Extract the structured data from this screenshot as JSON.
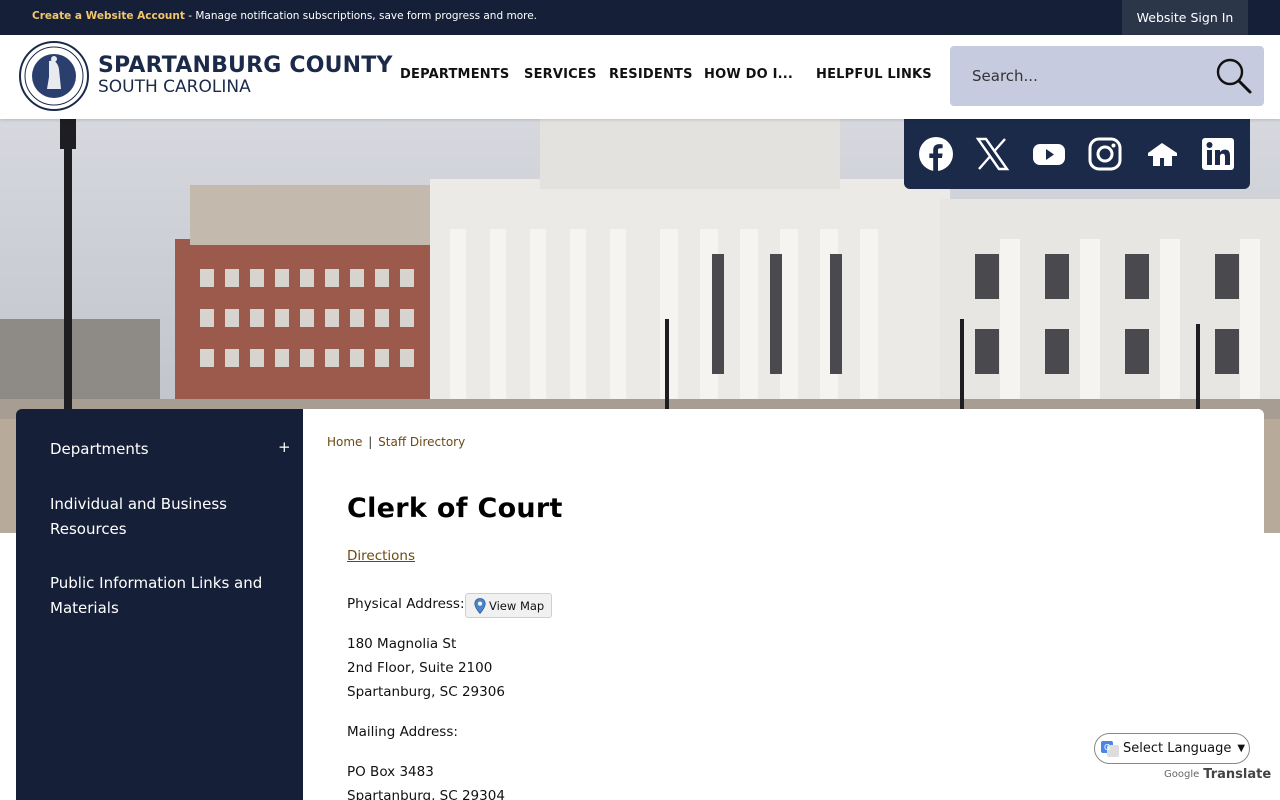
{
  "topbar": {
    "promo_link": "Create a Website Account",
    "promo_text": " - Manage notification subscriptions, save form progress and more.",
    "signin": "Website Sign In"
  },
  "header": {
    "site_title": "SPARTANBURG COUNTY",
    "site_subtitle": "SOUTH CAROLINA",
    "nav": [
      "DEPARTMENTS",
      "SERVICES",
      "RESIDENTS",
      "HOW DO I...",
      "HELPFUL LINKS"
    ],
    "search_placeholder": "Search..."
  },
  "social": [
    "facebook-icon",
    "x-icon",
    "youtube-icon",
    "instagram-icon",
    "nextdoor-icon",
    "linkedin-icon"
  ],
  "sidebar": {
    "items": [
      {
        "label": "Departments",
        "toggle": "+"
      },
      {
        "label": "Individual and Business Resources"
      },
      {
        "label": "Public Information Links and Materials"
      }
    ]
  },
  "main": {
    "breadcrumb": {
      "home": "Home",
      "sep": "|",
      "current": "Staff Directory"
    },
    "title": "Clerk of Court",
    "directions": "Directions",
    "physical_label": "Physical Address:",
    "view_map": "View Map",
    "physical_address": [
      "180 Magnolia St",
      "2nd Floor, Suite 2100",
      "Spartanburg, SC 29306"
    ],
    "mailing_label": "Mailing Address:",
    "mailing_address": [
      "PO Box 3483",
      "Spartanburg, SC 29304"
    ]
  },
  "translate": {
    "select_label": "Select Language",
    "powered_by": "Google",
    "translate_word": "Translate"
  },
  "colors": {
    "navy": "#152038",
    "accent_gold": "#f2c66d",
    "link_brown": "#6b4a11",
    "search_bg": "#c7cbe0"
  }
}
